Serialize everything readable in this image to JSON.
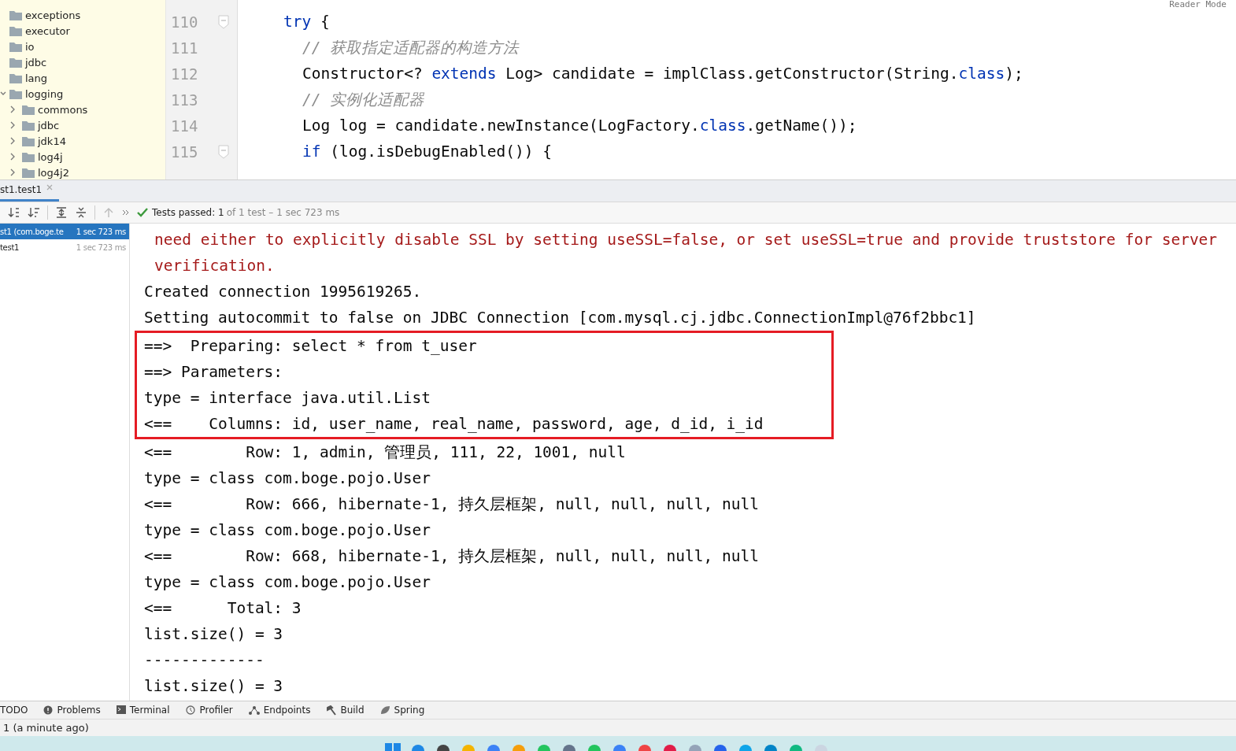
{
  "project_tree": {
    "items": [
      {
        "label": "exceptions"
      },
      {
        "label": "executor"
      },
      {
        "label": "io"
      },
      {
        "label": "jdbc"
      },
      {
        "label": "lang"
      },
      {
        "label": "logging",
        "expanded": true,
        "children": [
          {
            "label": "commons",
            "expanded": false
          },
          {
            "label": "jdbc",
            "expanded": false
          },
          {
            "label": "jdk14",
            "expanded": false
          },
          {
            "label": "log4j",
            "expanded": false
          },
          {
            "label": "log4j2",
            "expanded": false
          }
        ]
      }
    ]
  },
  "editor": {
    "reader_mode": "Reader Mode",
    "lines": [
      {
        "number": "110",
        "fold": true,
        "segments": [
          {
            "kind": "keyword",
            "text": "try"
          },
          {
            "kind": "plain",
            "text": " {"
          }
        ],
        "children": [
          {
            "number": "111",
            "segments": [
              {
                "kind": "comment",
                "text": "// 获取指定适配器的构造方法"
              }
            ]
          },
          {
            "number": "112",
            "segments": [
              {
                "kind": "plain",
                "text": "Constructor<? "
              },
              {
                "kind": "keyword",
                "text": "extends"
              },
              {
                "kind": "plain",
                "text": " Log> candidate = implClass.getConstructor(String."
              },
              {
                "kind": "keyword",
                "text": "class"
              },
              {
                "kind": "plain",
                "text": ");"
              }
            ]
          },
          {
            "number": "113",
            "segments": [
              {
                "kind": "comment",
                "text": "// 实例化适配器"
              }
            ]
          },
          {
            "number": "114",
            "segments": [
              {
                "kind": "plain",
                "text": "Log log = candidate.newInstance(LogFactory."
              },
              {
                "kind": "keyword",
                "text": "class"
              },
              {
                "kind": "plain",
                "text": ".getName());"
              }
            ]
          },
          {
            "number": "115",
            "fold": true,
            "segments": [
              {
                "kind": "keyword",
                "text": "if"
              },
              {
                "kind": "plain",
                "text": " (log.isDebugEnabled()) {"
              }
            ]
          }
        ]
      }
    ]
  },
  "run_tab": {
    "label": "st1.test1",
    "selected": true
  },
  "toolbar": {
    "passed": "Tests passed: 1",
    "detail": "of 1 test – 1 sec 723 ms"
  },
  "test_tree": [
    {
      "label": "st1 (com.boge.te",
      "time": "1 sec 723 ms",
      "selected": true
    },
    {
      "label": "test1",
      "time": "1 sec 723 ms",
      "selected": false
    }
  ],
  "console": {
    "before": [
      {
        "kind": "error",
        "text": "need either to explicitly disable SSL by setting useSSL=false, or set useSSL=true and provide truststore for server"
      },
      {
        "kind": "error",
        "text": "verification."
      },
      {
        "kind": "normal",
        "text": "Created connection 1995619265."
      },
      {
        "kind": "normal",
        "text": "Setting autocommit to false on JDBC Connection [com.mysql.cj.jdbc.ConnectionImpl@76f2bbc1]"
      }
    ],
    "highlighted": [
      "==>  Preparing: select * from t_user",
      "==> Parameters: ",
      "type = interface java.util.List",
      "<==    Columns: id, user_name, real_name, password, age, d_id, i_id"
    ],
    "after": [
      "<==        Row: 1, admin, 管理员, 111, 22, 1001, null",
      "type = class com.boge.pojo.User",
      "<==        Row: 666, hibernate-1, 持久层框架, null, null, null, null",
      "type = class com.boge.pojo.User",
      "<==        Row: 668, hibernate-1, 持久层框架, null, null, null, null",
      "type = class com.boge.pojo.User",
      "<==      Total: 3",
      "list.size() = 3",
      "-------------",
      "list.size() = 3"
    ]
  },
  "tool_windows": [
    {
      "kind": "todo",
      "label": "TODO"
    },
    {
      "kind": "problems",
      "label": "Problems"
    },
    {
      "kind": "terminal",
      "label": "Terminal"
    },
    {
      "kind": "profiler",
      "label": "Profiler"
    },
    {
      "kind": "endpoints",
      "label": "Endpoints"
    },
    {
      "kind": "build",
      "label": "Build"
    },
    {
      "kind": "spring",
      "label": "Spring"
    }
  ],
  "status_bar": {
    "text": "1 (a minute ago)"
  }
}
